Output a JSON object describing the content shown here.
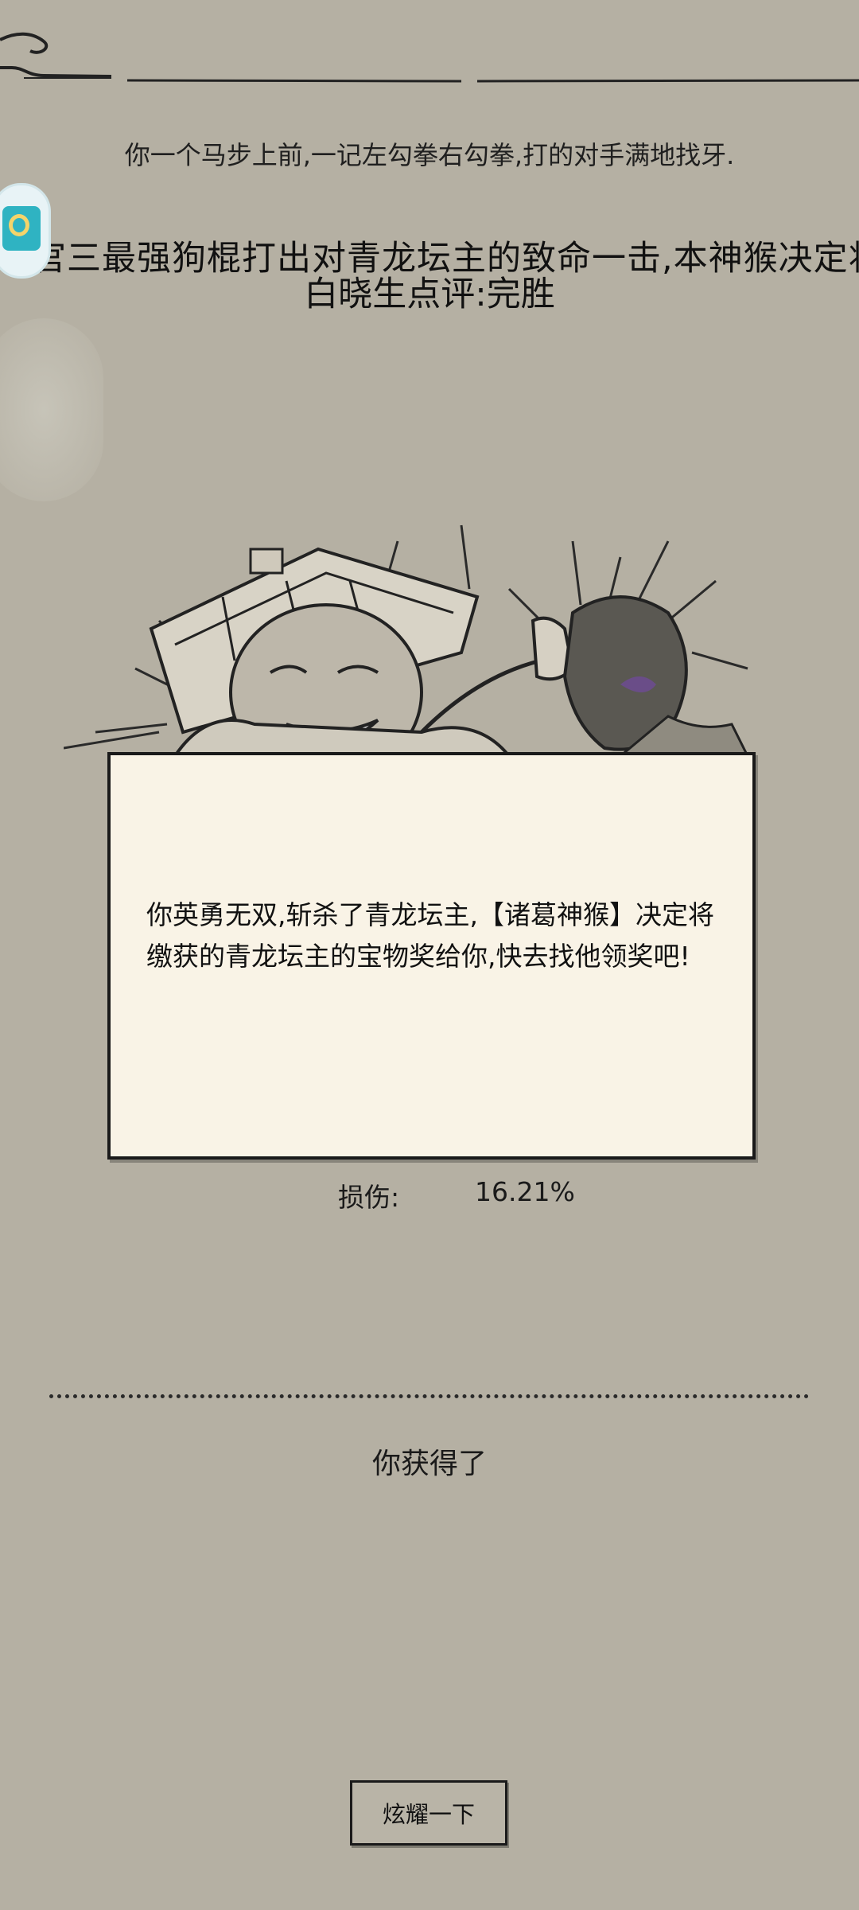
{
  "battle_narration": "你一个马步上前,一记左勾拳右勾拳,打的对手满地找牙.",
  "scrolling_announcement": "官三最强狗棍打出对青龙坛主的致命一击,本神猴决定将",
  "verdict": "白晓生点评:完胜",
  "result_message": "你英勇无双,斩杀了青龙坛主,【诸葛神猴】决定将缴获的青龙坛主的宝物奖给你,快去找他领奖吧!",
  "damage": {
    "label": "损伤:",
    "value": "16.21%"
  },
  "reward_title": "你获得了",
  "show_off_button": "炫耀一下",
  "icons": {
    "floating_widget": "floating-avatar-icon",
    "illustration": "battle-illustration"
  },
  "colors": {
    "background": "#b5b0a3",
    "card": "#f9f3e6",
    "ink": "#1a1a1a"
  }
}
